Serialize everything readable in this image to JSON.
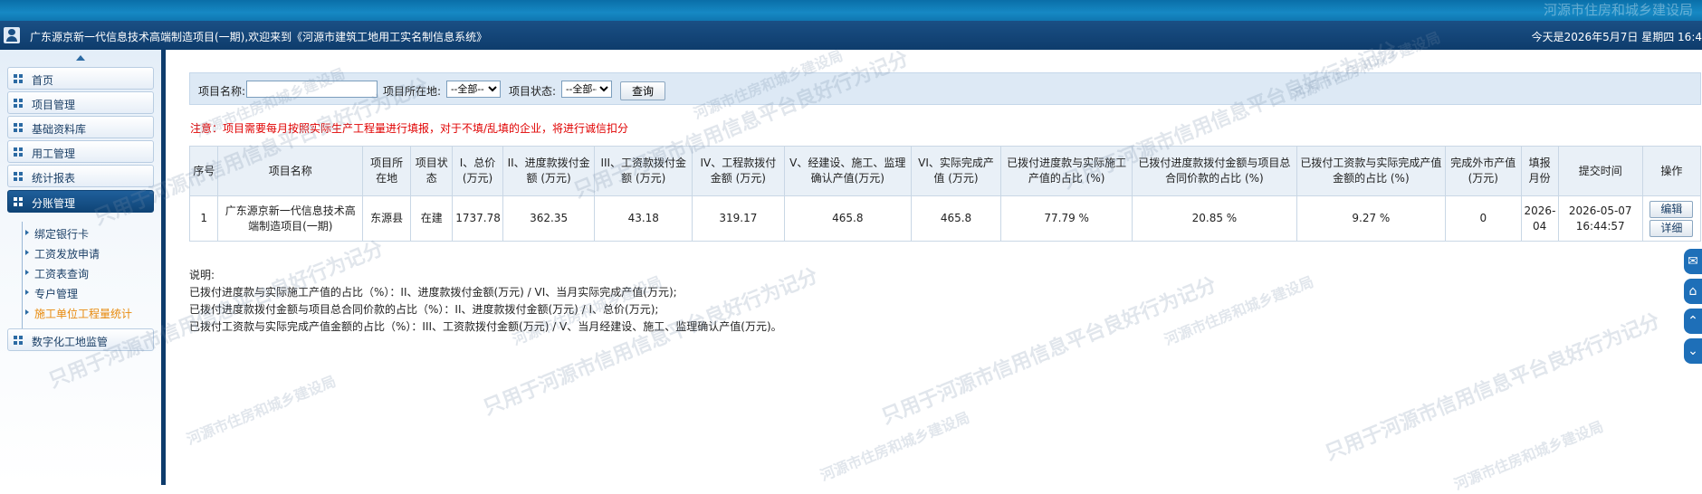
{
  "banner": {
    "org": "河源市住房和城乡建设局"
  },
  "header": {
    "welcome": "广东源京新一代信息技术高端制造项目(一期),欢迎来到《河源市建筑工地用工实名制信息系统》",
    "date": "今天是2026年5月7日 星期四 16:4"
  },
  "sidebar": {
    "items": [
      {
        "label": "首页"
      },
      {
        "label": "项目管理"
      },
      {
        "label": "基础资料库"
      },
      {
        "label": "用工管理"
      },
      {
        "label": "统计报表"
      },
      {
        "label": "分账管理"
      },
      {
        "label": "数字化工地监管"
      }
    ],
    "sub_items": [
      {
        "label": "绑定银行卡"
      },
      {
        "label": "工资发放申请"
      },
      {
        "label": "工资表查询"
      },
      {
        "label": "专户管理"
      },
      {
        "label": "施工单位工程量统计"
      }
    ]
  },
  "search": {
    "name_label": "项目名称:",
    "name_value": "",
    "location_label": "项目所在地:",
    "location_value": "--全部--",
    "status_label": "项目状态:",
    "status_value": "--全部--",
    "query_button": "查询"
  },
  "notice": "注意：项目需要每月按照实际生产工程量进行填报，对于不填/乱填的企业，将进行诚信扣分",
  "table": {
    "headers": [
      "序号",
      "项目名称",
      "项目所在地",
      "项目状态",
      "I、总价(万元)",
      "II、进度款拨付金额 (万元)",
      "III、工资款拨付金额 (万元)",
      "IV、工程款拨付金额 (万元)",
      "V、经建设、施工、监理确认产值(万元)",
      "VI、实际完成产值 (万元)",
      "已拨付进度款与实际施工产值的占比 (%)",
      "已拨付进度款拨付金额与项目总合同价款的占比 (%)",
      "已拨付工资款与实际完成产值金额的占比 (%)",
      "完成外市产值(万元)",
      "填报月份",
      "提交时间",
      "操作"
    ],
    "rows": [
      {
        "index": "1",
        "name": "广东源京新一代信息技术高端制造项目(一期)",
        "location": "东源县",
        "status": "在建",
        "total": "1737.78",
        "progress_pay": "362.35",
        "wage_pay": "43.18",
        "project_pay": "319.17",
        "confirmed_value": "465.8",
        "actual_value": "465.8",
        "ratio1": "77.79 %",
        "ratio2": "20.85 %",
        "ratio3": "9.27 %",
        "outside_value": "0",
        "month": "2026-04",
        "submit_time": "2026-05-07 16:44:57",
        "edit_button": "编辑",
        "detail_button": "详细"
      }
    ]
  },
  "notes": {
    "title": "说明:",
    "lines": [
      "已拨付进度款与实际施工产值的占比（%）：II、进度款拨付金额(万元) / VI、当月实际完成产值(万元);",
      "已拨付进度款拨付金额与项目总合同价款的占比（%）：II、进度款拨付金额(万元) / I、总价(万元);",
      "已拨付工资款与实际完成产值金额的占比（%）：III、工资款拨付金额(万元) / V、当月经建设、施工、监理确认产值(万元)。"
    ]
  },
  "watermark": {
    "text_a": "只用于河源市信用信息平台良好行为记分",
    "text_b": "河源市住房和城乡建设局"
  },
  "float_tools": [
    "chat-icon",
    "home-icon",
    "up-arrow-icon",
    "down-arrow-icon"
  ]
}
